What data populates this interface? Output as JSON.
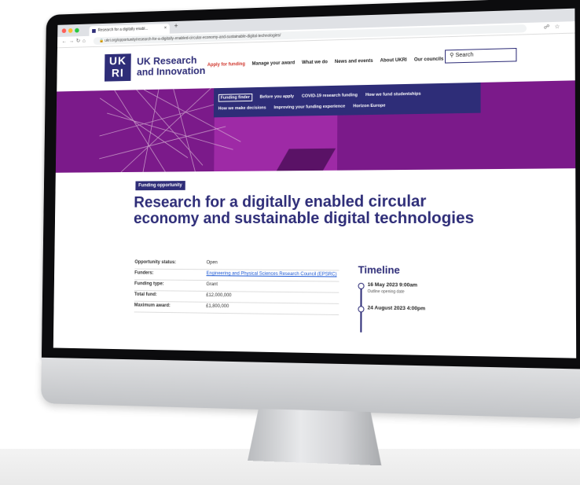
{
  "browser": {
    "tab_title": "Research for a digitally enabl...",
    "tab_close": "×",
    "new_tab": "+",
    "url": "ukri.org/opportunity/research-for-a-digitally-enabled-circular-economy-and-sustainable-digital-technologies/"
  },
  "header": {
    "logo_text": "UK RI",
    "brand_line1": "UK Research",
    "brand_line2": "and Innovation",
    "nav": [
      "Apply for funding",
      "Manage your award",
      "What we do",
      "News and events",
      "About UKRI",
      "Our councils"
    ],
    "search_label": "Search"
  },
  "subnav": {
    "row1": [
      "Funding finder",
      "Before you apply",
      "COVID-19 research funding",
      "How we fund studentships"
    ],
    "row2": [
      "How we make decisions",
      "Improving your funding experience",
      "Horizon Europe"
    ]
  },
  "page": {
    "badge": "Funding opportunity",
    "title": "Research for a digitally enabled circular economy and sustainable digital technologies"
  },
  "details": [
    {
      "label": "Opportunity status:",
      "value": "Open",
      "link": false
    },
    {
      "label": "Funders:",
      "value": "Engineering and Physical Sciences Research Council (EPSRC)",
      "link": true
    },
    {
      "label": "Funding type:",
      "value": "Grant",
      "link": false
    },
    {
      "label": "Total fund:",
      "value": "£12,000,000",
      "link": false
    },
    {
      "label": "Maximum award:",
      "value": "£1,800,000",
      "link": false
    }
  ],
  "timeline": {
    "title": "Timeline",
    "items": [
      {
        "date": "16 May 2023 9:00am",
        "desc": "Outline opening date"
      },
      {
        "date": "24 August 2023 4:00pm",
        "desc": ""
      }
    ]
  },
  "colors": {
    "brand": "#2e2d78",
    "hero": "#7b1a8a",
    "apply_link": "#d0362c",
    "link": "#1d59d4"
  }
}
